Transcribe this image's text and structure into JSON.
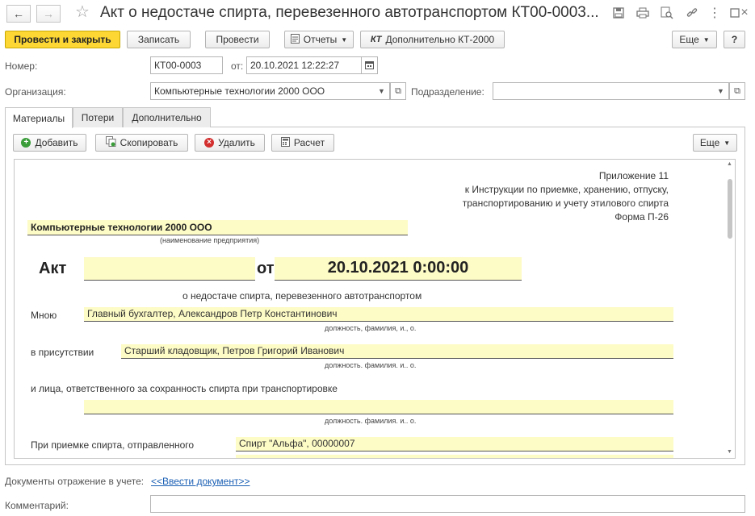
{
  "window": {
    "title": "Акт о недостаче спирта, перевезенного автотранспортом КТ00-0003..."
  },
  "toolbar": {
    "post_close": "Провести и закрыть",
    "save": "Записать",
    "post": "Провести",
    "reports": "Отчеты",
    "kt_badge": "КТ",
    "extra_kt": "Дополнительно КТ-2000",
    "more": "Еще",
    "help": "?"
  },
  "header": {
    "number_label": "Номер:",
    "number_value": "КТ00-0003",
    "date_label": "от:",
    "date_value": "20.10.2021 12:22:27",
    "org_label": "Организация:",
    "org_value": "Компьютерные технологии 2000 ООО",
    "dept_label": "Подразделение:",
    "dept_value": ""
  },
  "tabs": [
    {
      "label": "Материалы"
    },
    {
      "label": "Потери"
    },
    {
      "label": "Дополнительно"
    }
  ],
  "tab_toolbar": {
    "add": "Добавить",
    "copy": "Скопировать",
    "delete": "Удалить",
    "calc": "Расчет",
    "more": "Еще"
  },
  "report": {
    "appendix_lines": [
      "Приложение 11",
      "к Инструкции по приемке, хранению, отпуску,",
      "транспортированию и учету этилового спирта",
      "Форма П-26"
    ],
    "org_name": "Компьютерные технологии 2000 ООО",
    "org_caption": "(наименование предприятия)",
    "act_label": "Акт",
    "act_number": "",
    "from_label": "от",
    "act_date": "20.10.2021 0:00:00",
    "subtitle": "о недостаче спирта, перевезенного автотранспортом",
    "by_me_label": "Мною",
    "by_me_value": "Главный бухгалтер, Александров Петр Константинович",
    "position_caption": "должность, фамилия, и., о.",
    "presence_label": "в присутствии",
    "presence_value": "Старший кладовщик, Петров Григорий Иванович",
    "position_caption_2": "должность. фамилия. и.. о.",
    "responsible_label": "и лица, ответственного за сохранность спирта при транспортировке",
    "responsible_value": "",
    "position_caption_3": "должность. фамилия. и.. о.",
    "acceptance_label": "При приемке спирта, отправленного",
    "acceptance_value": "Спирт \"Альфа\", 00000007"
  },
  "footer": {
    "docs_label": "Документы отражение в учете:",
    "docs_link": "<<Ввести документ>>",
    "comment_label": "Комментарий:",
    "comment_value": ""
  },
  "colors": {
    "accent_yellow": "#fdd835",
    "field_yellow": "#fdfbc6",
    "link_blue": "#1a5fb4"
  }
}
